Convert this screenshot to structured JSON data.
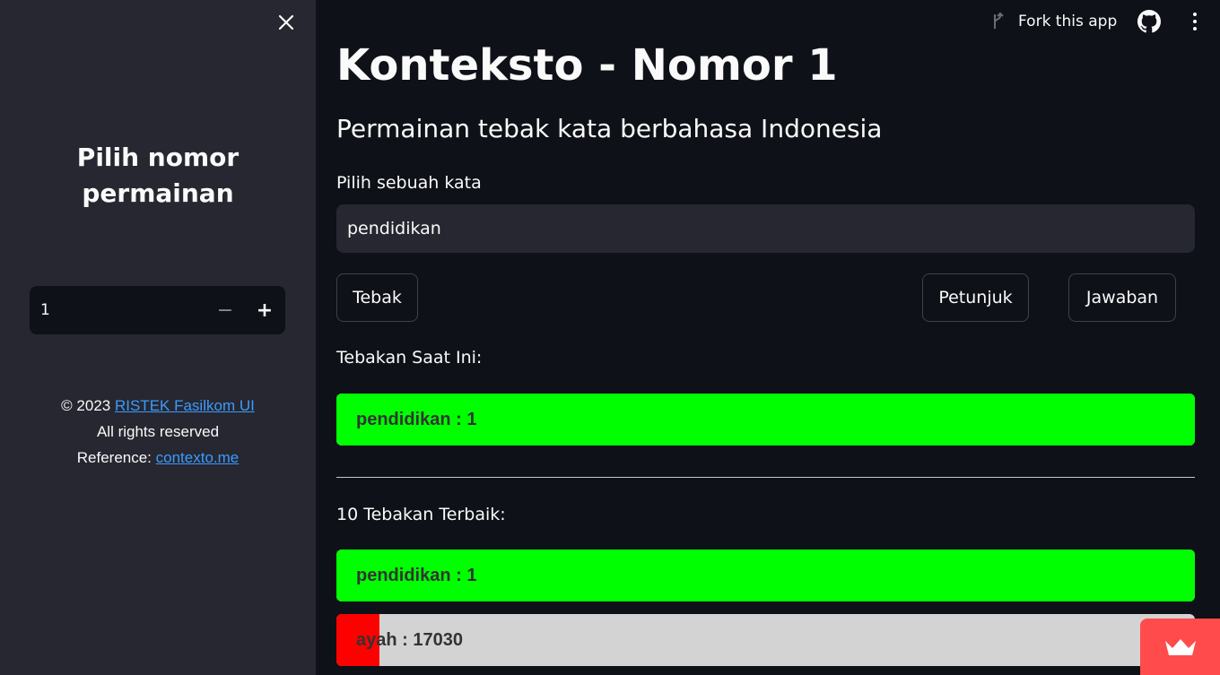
{
  "sidebar": {
    "title": "Pilih nomor permainan",
    "game_number": "1",
    "minus_label": "−",
    "plus_label": "+",
    "footer": {
      "copyright_prefix": "© 2023 ",
      "org_link": "RISTEK Fasilkom UI",
      "rights": "All rights reserved",
      "reference_prefix": "Reference: ",
      "reference_link": "contexto.me"
    }
  },
  "topbar": {
    "fork_label": "Fork this app",
    "fork_icon": "fork-icon",
    "github_icon": "github-icon",
    "menu_icon": "kebab-menu-icon"
  },
  "main": {
    "title": "Konteksto - Nomor 1",
    "subtitle": "Permainan tebak kata berbahasa Indonesia",
    "input_label": "Pilih sebuah kata",
    "input_value": "pendidikan",
    "buttons": {
      "guess": "Tebak",
      "hint": "Petunjuk",
      "answer": "Jawaban"
    },
    "current_label": "Tebakan Saat Ini:",
    "current_guess": {
      "text": "pendidikan : 1",
      "rank": 1,
      "fill_fraction": 1.0,
      "color": "#00ff00"
    },
    "best_label": "10 Tebakan Terbaik:",
    "best_guesses": [
      {
        "text": "pendidikan : 1",
        "rank": 1,
        "fill_fraction": 1.0,
        "color": "#00ff00"
      },
      {
        "text": "ayah : 17030",
        "rank": 17030,
        "fill_fraction": 0.05,
        "color": "#ff0000"
      }
    ]
  },
  "colors": {
    "background": "#0e1117",
    "sidebar": "#262730",
    "accent": "#ff4b4b",
    "link": "#3b9bff",
    "bar_track": "#d3d3d3"
  }
}
